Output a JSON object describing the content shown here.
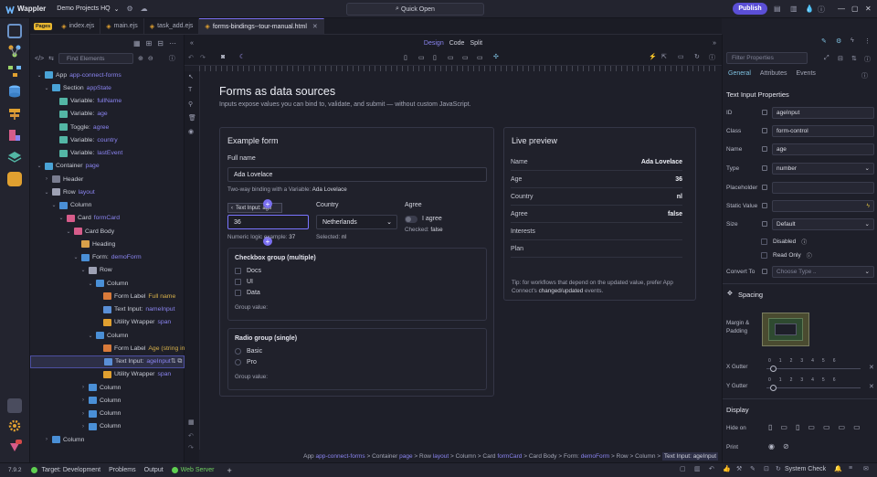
{
  "app": {
    "name": "Wappler",
    "project": "Demo Projects HQ",
    "quick_open": "Quick Open",
    "publish": "Publish"
  },
  "tabs": {
    "pages_badge": "Pages",
    "items": [
      "index.ejs",
      "main.ejs",
      "task_add.ejs",
      "forms-bindings--tour-manual.html"
    ]
  },
  "tree": {
    "find_placeholder": "Find Elements",
    "rows": [
      {
        "label": "App",
        "var": "app-connect-forms",
        "color": "#4aa3d6"
      },
      {
        "label": "Section",
        "var": "appState",
        "color": "#4aa3d6"
      },
      {
        "label": "Variable:",
        "var": "fullName",
        "color": "#53b6a5"
      },
      {
        "label": "Variable:",
        "var": "age",
        "color": "#53b6a5"
      },
      {
        "label": "Toggle:",
        "var": "agree",
        "color": "#53b6a5"
      },
      {
        "label": "Variable:",
        "var": "country",
        "color": "#53b6a5"
      },
      {
        "label": "Variable:",
        "var": "lastEvent",
        "color": "#53b6a5"
      },
      {
        "label": "Container",
        "var": "page",
        "color": "#4aa3d6"
      },
      {
        "label": "Header",
        "var": "",
        "color": "#7a7d90"
      },
      {
        "label": "Row",
        "var": "layout",
        "color": "#9ea1b4"
      },
      {
        "label": "Column",
        "var": "",
        "color": "#4a8fd6"
      },
      {
        "label": "Card",
        "var": "formCard",
        "color": "#d65c8a"
      },
      {
        "label": "Card Body",
        "var": "",
        "color": "#d65c8a"
      },
      {
        "label": "Heading",
        "var": "",
        "color": "#d9a04a"
      },
      {
        "label": "Form:",
        "var": "demoForm",
        "color": "#4a8fd6"
      },
      {
        "label": "Row",
        "var": "",
        "color": "#9ea1b4"
      },
      {
        "label": "Column",
        "var": "",
        "color": "#4a8fd6"
      },
      {
        "label": "Form Label",
        "var": "Full name",
        "color": "#d97a3a"
      },
      {
        "label": "Text Input:",
        "var": "nameInput",
        "color": "#5a8fd6"
      },
      {
        "label": "Utility Wrapper",
        "var": "span",
        "color": "#e0a030"
      },
      {
        "label": "Column",
        "var": "",
        "color": "#4a8fd6"
      },
      {
        "label": "Form Label",
        "var": "Age (string input)",
        "color": "#d97a3a"
      },
      {
        "label": "Text Input:",
        "var": "ageInput",
        "color": "#5a8fd6"
      },
      {
        "label": "Utility Wrapper",
        "var": "span",
        "color": "#e0a030"
      },
      {
        "label": "Column",
        "var": "",
        "color": "#4a8fd6"
      },
      {
        "label": "Column",
        "var": "",
        "color": "#4a8fd6"
      },
      {
        "label": "Column",
        "var": "",
        "color": "#4a8fd6"
      },
      {
        "label": "Column",
        "var": "",
        "color": "#4a8fd6"
      },
      {
        "label": "Column",
        "var": "",
        "color": "#4a8fd6"
      }
    ]
  },
  "view_modes": {
    "design": "Design",
    "code": "Code",
    "split": "Split"
  },
  "page": {
    "title": "Forms as data sources",
    "subtitle": "Inputs expose values you can bind to, validate, and submit — without custom JavaScript.",
    "form_card": {
      "title": "Example form",
      "full_name_label": "Full name",
      "full_name_value": "Ada Lovelace",
      "binding_hint": "Two-way binding with a Variable:",
      "binding_value": "Ada Lovelace",
      "age_value": "36",
      "age_hint": "Numeric logic example:",
      "age_hint_value": "37",
      "tooltip": "Text Input: age",
      "country_label": "Country",
      "country_value": "Netherlands",
      "selected_hint": "Selected:",
      "selected_value": "nl",
      "agree_label": "Agree",
      "agree_text": "I agree",
      "checked_hint": "Checked:",
      "checked_value": "false",
      "checkbox_group": {
        "title": "Checkbox group (multiple)",
        "options": [
          "Docs",
          "UI",
          "Data"
        ],
        "value_label": "Group value:"
      },
      "radio_group": {
        "title": "Radio group (single)",
        "options": [
          "Basic",
          "Pro"
        ],
        "value_label": "Group value:"
      }
    },
    "preview_card": {
      "title": "Live preview",
      "rows": [
        {
          "k": "Name",
          "v": "Ada Lovelace"
        },
        {
          "k": "Age",
          "v": "36"
        },
        {
          "k": "Country",
          "v": "nl"
        },
        {
          "k": "Agree",
          "v": "false"
        },
        {
          "k": "Interests",
          "v": ""
        },
        {
          "k": "Plan",
          "v": ""
        }
      ],
      "tip_prefix": "Tip: for workflows that depend on the updated value, prefer App Connect's",
      "tip_bold": "changed/updated",
      "tip_suffix": "events."
    }
  },
  "props": {
    "filter_placeholder": "Filter Properties",
    "tabs": [
      "General",
      "Attributes",
      "Events"
    ],
    "section_title": "Text Input Properties",
    "id_label": "ID",
    "id_value": "ageInput",
    "class_label": "Class",
    "class_value": "form-control",
    "name_label": "Name",
    "name_value": "age",
    "type_label": "Type",
    "type_value": "number",
    "placeholder_label": "Placeholder",
    "static_value_label": "Static Value",
    "size_label": "Size",
    "size_value": "Default",
    "disabled_label": "Disabled",
    "readonly_label": "Read Only",
    "convert_label": "Convert To",
    "convert_value": "Choose Type ..",
    "spacing_title": "Spacing",
    "margin_label": "Margin & Padding",
    "x_gutter": "X Gutter",
    "y_gutter": "Y Gutter",
    "gutter_ticks": [
      "0",
      "1",
      "2",
      "3",
      "4",
      "5",
      "6"
    ],
    "display_title": "Display",
    "hide_on": "Hide on",
    "print": "Print"
  },
  "breadcrumb": [
    "App",
    "app-connect-forms",
    "Container",
    "page",
    "Row",
    "layout",
    "Column",
    "Card",
    "formCard",
    "Card Body",
    "Form:",
    "demoForm",
    "Row",
    "Column",
    "Text Input:",
    "ageInput"
  ],
  "status": {
    "version": "7.9.2",
    "target": "Target: Development",
    "problems": "Problems",
    "output": "Output",
    "web_server": "Web Server",
    "system_check": "System Check"
  }
}
